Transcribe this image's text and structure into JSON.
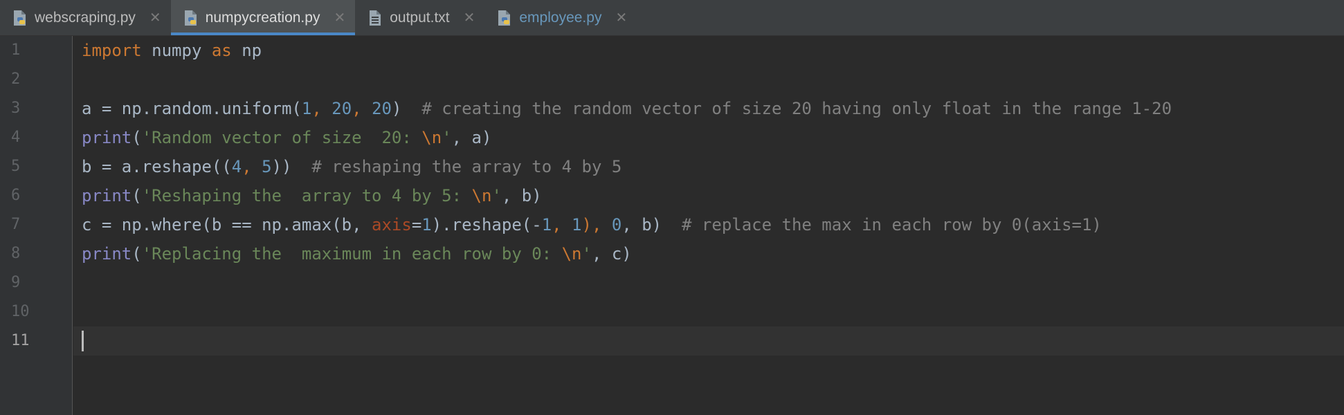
{
  "tabs": [
    {
      "label": "webscraping.py",
      "icon": "python-file-icon"
    },
    {
      "label": "numpycreation.py",
      "icon": "python-file-icon",
      "active": true
    },
    {
      "label": "output.txt",
      "icon": "text-file-icon"
    },
    {
      "label": "employee.py",
      "icon": "python-file-icon",
      "modified": true
    }
  ],
  "tab_close_glyph": "✕",
  "line_numbers": [
    "1",
    "2",
    "3",
    "4",
    "5",
    "6",
    "7",
    "8",
    "9",
    "10",
    "11"
  ],
  "code": {
    "l1": {
      "t1": "import",
      "t2": " numpy ",
      "t3": "as",
      "t4": " np"
    },
    "l3": {
      "t1": "a = np.random.uniform(",
      "t2": "1",
      "t3": ", ",
      "t4": "20",
      "t5": ", ",
      "t6": "20",
      "t7": ")  ",
      "t8": "# creating the random vector of size 20 having only float in the range 1-20"
    },
    "l4": {
      "t1": "print",
      "t2": "(",
      "t3": "'Random vector of size  20: ",
      "t4": "\\n",
      "t5": "'",
      "t6": ", a)"
    },
    "l5": {
      "t1": "b = a.reshape((",
      "t2": "4",
      "t3": ", ",
      "t4": "5",
      "t5": "))  ",
      "t6": "# reshaping the array to 4 by 5"
    },
    "l6": {
      "t1": "print",
      "t2": "(",
      "t3": "'Reshaping the  array to 4 by 5: ",
      "t4": "\\n",
      "t5": "'",
      "t6": ", b)"
    },
    "l7": {
      "t1": "c = np.where(b == np.amax(b, ",
      "t2": "axis",
      "t3": "=",
      "t4": "1",
      "t5": ").reshape(-",
      "t6": "1",
      "t7": ", ",
      "t8": "1",
      "t9": "), ",
      "t10": "0",
      "t11": ", b)  ",
      "t12": "# replace the max in each row by 0(axis=1)"
    },
    "l8": {
      "t1": "print",
      "t2": "(",
      "t3": "'Replacing the  maximum in each row by 0: ",
      "t4": "\\n",
      "t5": "'",
      "t6": ", c)"
    }
  },
  "colors": {
    "background": "#2b2b2b",
    "keyword": "#cc7832",
    "number": "#6897bb",
    "string": "#6a8759",
    "comment": "#808080",
    "builtin": "#8888c6",
    "active_tab_underline": "#4a88c7"
  }
}
